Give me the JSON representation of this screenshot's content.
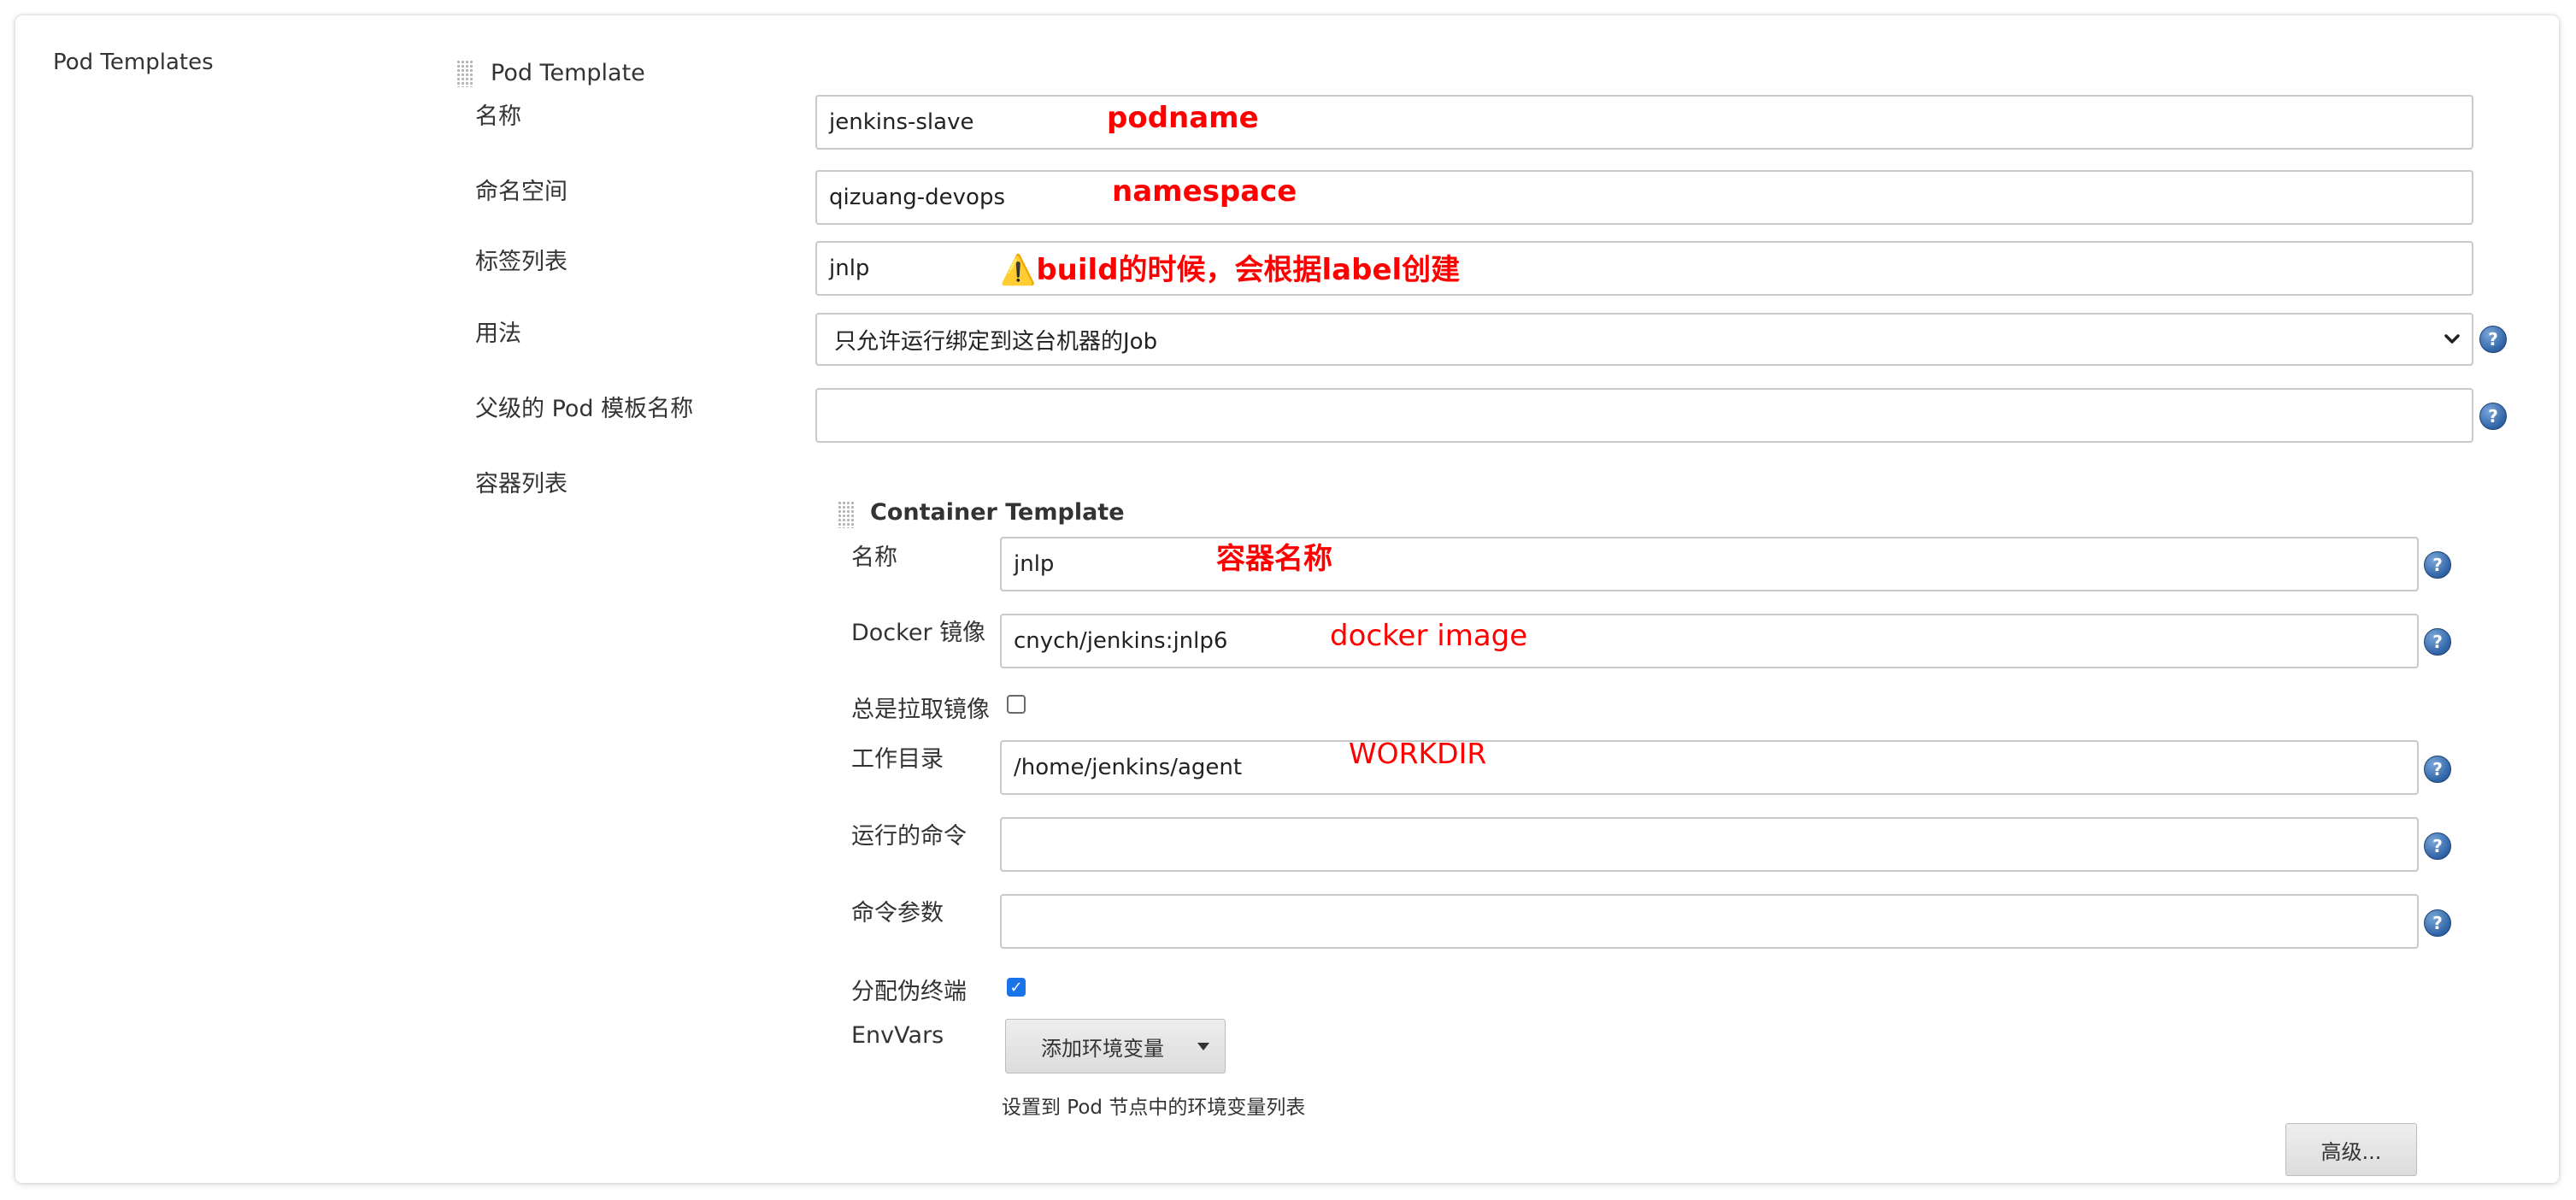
{
  "section": {
    "title": "Pod Templates"
  },
  "pod_template": {
    "title": "Pod Template",
    "fields": {
      "name": {
        "label": "名称",
        "value": "jenkins-slave",
        "annotation": "podname"
      },
      "namespace": {
        "label": "命名空间",
        "value": "qizuang-devops",
        "annotation": "namespace"
      },
      "labels": {
        "label": "标签列表",
        "value": "jnlp",
        "annotation_icon": "⚠️",
        "annotation": "build的时候，会根据label创建"
      },
      "usage": {
        "label": "用法",
        "selected": "只允许运行绑定到这台机器的Job"
      },
      "parent": {
        "label": "父级的 Pod 模板名称",
        "value": ""
      },
      "containers": {
        "label": "容器列表"
      }
    }
  },
  "container_template": {
    "title": "Container Template",
    "fields": {
      "name": {
        "label": "名称",
        "value": "jnlp",
        "annotation": "容器名称"
      },
      "image": {
        "label": "Docker 镜像",
        "value": "cnych/jenkins:jnlp6",
        "annotation": "docker image"
      },
      "always_pull": {
        "label": "总是拉取镜像",
        "checked": false
      },
      "workdir": {
        "label": "工作目录",
        "value": "/home/jenkins/agent",
        "annotation": "WORKDIR"
      },
      "command": {
        "label": "运行的命令",
        "value": ""
      },
      "args": {
        "label": "命令参数",
        "value": ""
      },
      "tty": {
        "label": "分配伪终端",
        "checked": true
      },
      "envvars": {
        "label": "EnvVars",
        "add_button": "添加环境变量",
        "hint": "设置到 Pod 节点中的环境变量列表"
      }
    },
    "advanced_button": "高级..."
  },
  "help_symbol": "?",
  "icons": {
    "help": "help-icon",
    "grip": "drag-handle-icon",
    "select_caret": "chevron-down-icon",
    "dropdown": "dropdown-arrow-icon"
  },
  "colors": {
    "annotation": "#ff0000",
    "help": "#2f63a6",
    "checkbox": "#1a73e8"
  }
}
